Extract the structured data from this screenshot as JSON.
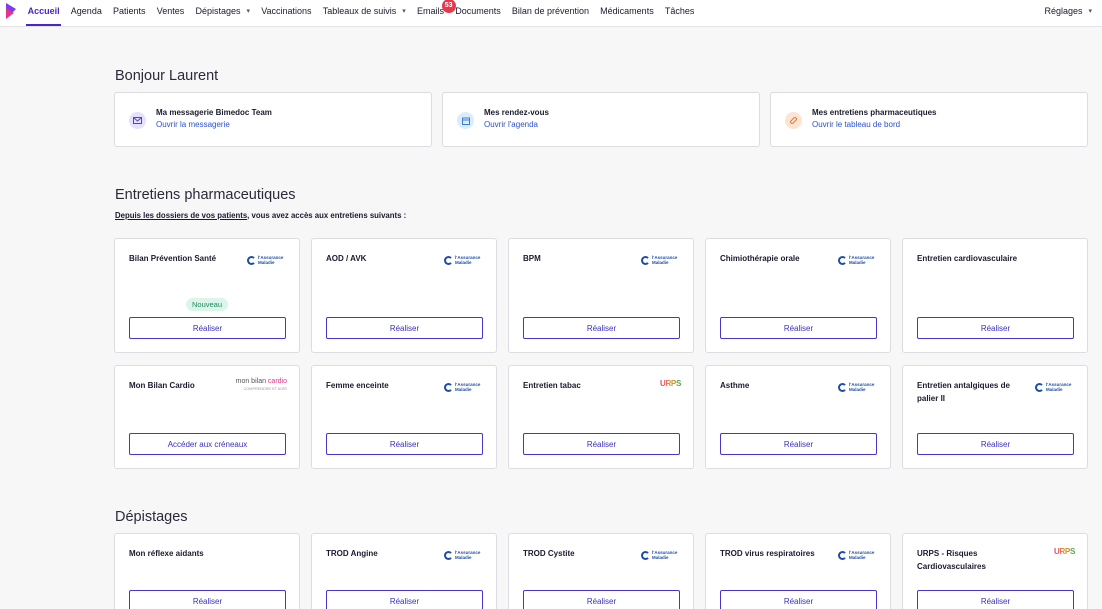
{
  "colors": {
    "accent": "#4a25c9",
    "link": "#2a4fd0",
    "badge": "#e5394d",
    "new_badge_bg": "#dcf5ea",
    "new_badge_text": "#1f8a57"
  },
  "nav": {
    "items": [
      {
        "label": "Accueil",
        "active": true
      },
      {
        "label": "Agenda"
      },
      {
        "label": "Patients"
      },
      {
        "label": "Ventes"
      },
      {
        "label": "Dépistages",
        "dropdown": true
      },
      {
        "label": "Vaccinations"
      },
      {
        "label": "Tableaux de suivis",
        "dropdown": true
      },
      {
        "label": "Emails",
        "badge": "53"
      },
      {
        "label": "Documents"
      },
      {
        "label": "Bilan de prévention"
      },
      {
        "label": "Médicaments"
      },
      {
        "label": "Tâches"
      }
    ],
    "settings": "Réglages"
  },
  "greeting": "Bonjour Laurent",
  "quick_cards": [
    {
      "title": "Ma messagerie Bimedoc Team",
      "link": "Ouvrir la messagerie",
      "icon": "mail-icon"
    },
    {
      "title": "Mes rendez-vous",
      "link": "Ouvrir l'agenda",
      "icon": "calendar-icon"
    },
    {
      "title": "Mes entretiens pharmaceutiques",
      "link": "Ouvrir le tableau de bord",
      "icon": "pill-icon"
    }
  ],
  "entretiens": {
    "title": "Entretiens pharmaceutiques",
    "subtitle_link": "Depuis les dossiers de vos patients",
    "subtitle_rest": ", vous avez accès aux entretiens suivants :",
    "cards": [
      {
        "title": "Bilan Prévention Santé",
        "logo": "assurance-maladie",
        "button": "Réaliser",
        "badge": "Nouveau"
      },
      {
        "title": "AOD / AVK",
        "logo": "assurance-maladie",
        "button": "Réaliser"
      },
      {
        "title": "BPM",
        "logo": "assurance-maladie",
        "button": "Réaliser"
      },
      {
        "title": "Chimiothérapie orale",
        "logo": "assurance-maladie",
        "button": "Réaliser"
      },
      {
        "title": "Entretien cardiovasculaire",
        "logo": "",
        "button": "Réaliser"
      },
      {
        "title": "Mon Bilan Cardio",
        "logo": "mon-bilan-cardio",
        "button": "Accéder aux créneaux"
      },
      {
        "title": "Femme enceinte",
        "logo": "assurance-maladie",
        "button": "Réaliser"
      },
      {
        "title": "Entretien tabac",
        "logo": "urps",
        "button": "Réaliser"
      },
      {
        "title": "Asthme",
        "logo": "assurance-maladie",
        "button": "Réaliser"
      },
      {
        "title": "Entretien antalgiques de palier II",
        "logo": "assurance-maladie",
        "button": "Réaliser"
      }
    ]
  },
  "depistages": {
    "title": "Dépistages",
    "cards": [
      {
        "title": "Mon réflexe aidants",
        "logo": "",
        "button": "Réaliser"
      },
      {
        "title": "TROD Angine",
        "logo": "assurance-maladie",
        "button": "Réaliser"
      },
      {
        "title": "TROD Cystite",
        "logo": "assurance-maladie",
        "button": "Réaliser"
      },
      {
        "title": "TROD virus respiratoires",
        "logo": "assurance-maladie",
        "button": "Réaliser"
      },
      {
        "title": "URPS - Risques Cardiovasculaires",
        "logo": "urps",
        "button": "Réaliser"
      }
    ]
  },
  "logos": {
    "assurance_maladie": [
      "l'Assurance",
      "Maladie"
    ],
    "mon_bilan_cardio": {
      "a": "mon bilan ",
      "b": "cardio",
      "sub": "COMPRENDRE ET AGIR"
    },
    "urps": "URPS"
  }
}
